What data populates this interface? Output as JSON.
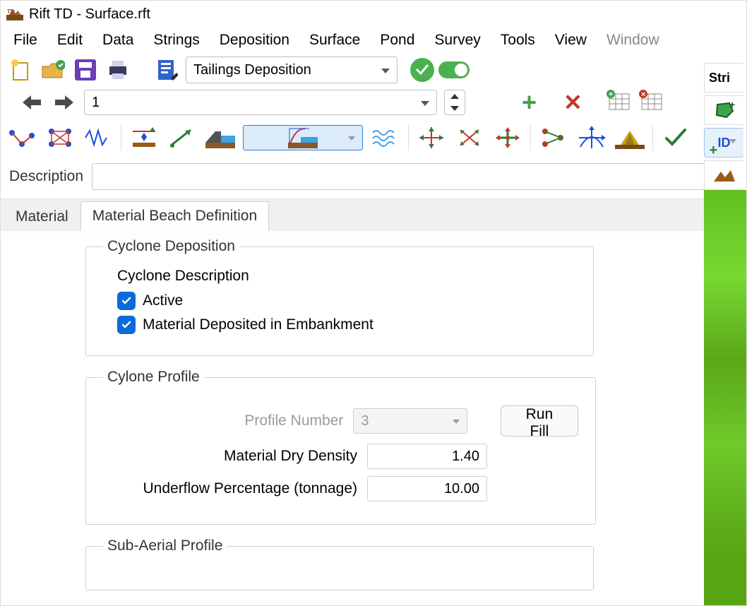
{
  "window": {
    "title": "Rift TD - Surface.rft"
  },
  "menus": [
    "File",
    "Edit",
    "Data",
    "Strings",
    "Deposition",
    "Surface",
    "Pond",
    "Survey",
    "Tools",
    "View",
    "Window"
  ],
  "toolbar1": {
    "dropdown": "Tailings Deposition"
  },
  "toolbar2": {
    "index": "1"
  },
  "description": {
    "label": "Description",
    "value": ""
  },
  "tabs": {
    "material": "Material",
    "beach": "Material Beach Definition"
  },
  "cyclone": {
    "legend": "Cyclone Deposition",
    "desc_label": "Cyclone Description",
    "active_label": "Active",
    "embank_label": "Material Deposited in Embankment"
  },
  "profile": {
    "legend": "Cylone Profile",
    "profile_num_label": "Profile Number",
    "profile_num": "3",
    "density_label": "Material Dry Density",
    "density": "1.40",
    "underflow_label": "Underflow Percentage (tonnage)",
    "underflow": "10.00",
    "runfill": "Run Fill"
  },
  "subaerial": {
    "legend": "Sub-Aerial Profile"
  },
  "right": {
    "stri": "Stri",
    "id": "ID"
  }
}
